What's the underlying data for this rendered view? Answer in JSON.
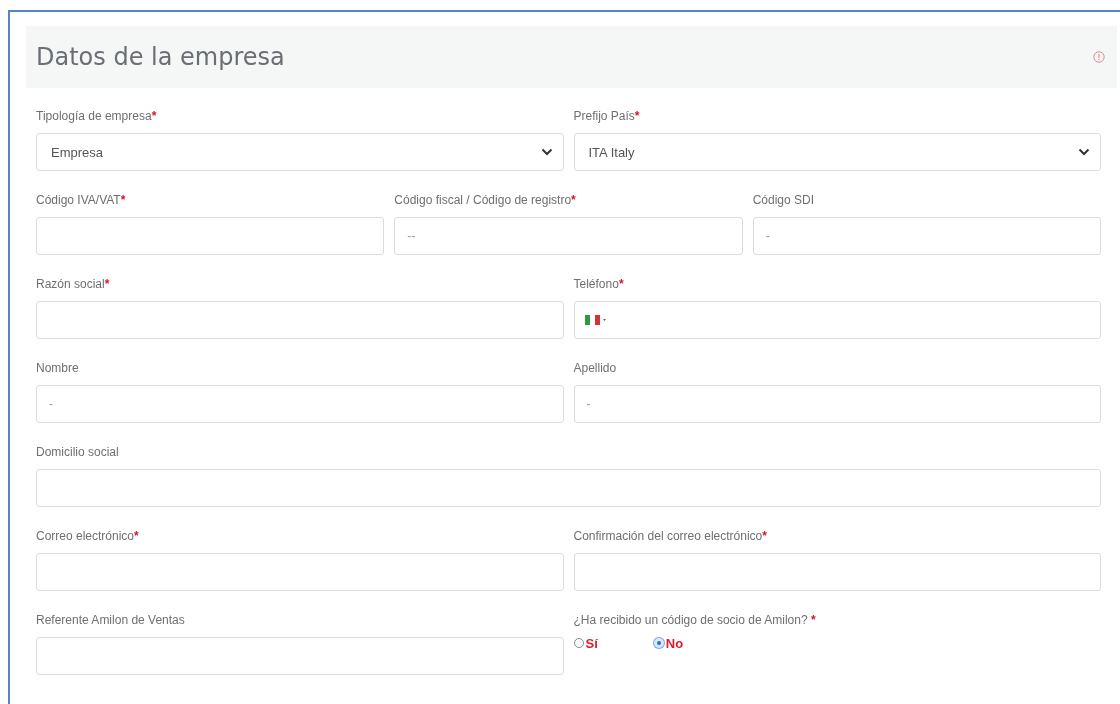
{
  "section": {
    "title": "Datos de la empresa",
    "alert": true
  },
  "rows": [
    {
      "fields": [
        {
          "kind": "select",
          "label": "Tipología de empresa",
          "mark": "*",
          "value": "Empresa"
        },
        {
          "kind": "select",
          "label": "Prefijo País",
          "mark": "*",
          "value": "ITA Italy"
        }
      ]
    },
    {
      "fields": [
        {
          "kind": "text",
          "label": "Código IVA/VAT",
          "mark": "*"
        },
        {
          "kind": "text",
          "label": "Código fiscal / Código de registro",
          "mark": "*",
          "placeholder": "--"
        },
        {
          "kind": "text",
          "label": "Código SDI",
          "placeholder": "-"
        }
      ]
    },
    {
      "fields": [
        {
          "kind": "text",
          "label": "Razón social",
          "mark": "*"
        },
        {
          "kind": "phone",
          "label": "Teléfono",
          "mark": "*"
        }
      ]
    },
    {
      "fields": [
        {
          "kind": "text",
          "label": "Nombre",
          "placeholder": "-"
        },
        {
          "kind": "text",
          "label": "Apellido",
          "placeholder": "-"
        }
      ]
    },
    {
      "fields": [
        {
          "kind": "text",
          "label": "Domicilio social"
        }
      ]
    },
    {
      "fields": [
        {
          "kind": "text",
          "label": "Correo electrónico",
          "mark": "*"
        },
        {
          "kind": "text",
          "label": "Confirmación del correo electrónico",
          "mark": "*"
        }
      ]
    },
    {
      "fields": [
        {
          "kind": "text",
          "label": "Referente Amilon de Ventas"
        },
        {
          "kind": "radio",
          "label": "¿Ha recibido un código de socio de Amilon?",
          "mark": " *",
          "options": [
            {
              "label": "Sí",
              "selected": false
            },
            {
              "label": "No",
              "selected": true
            }
          ]
        }
      ]
    }
  ]
}
